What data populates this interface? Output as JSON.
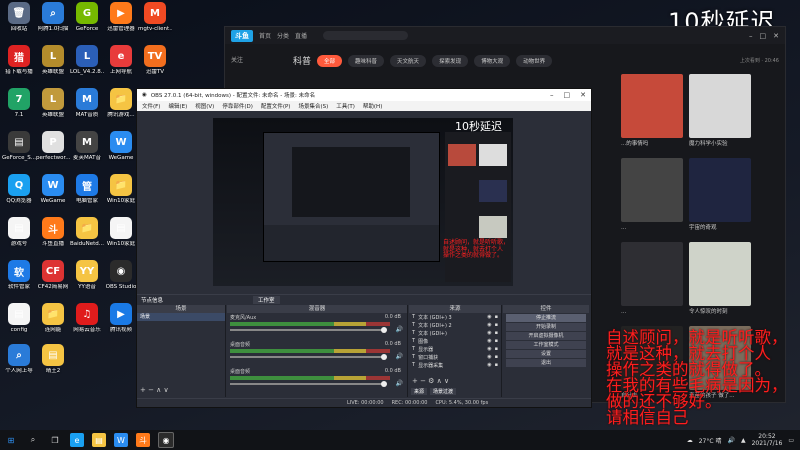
{
  "overlay_title": "10秒延迟",
  "desktop_icons": [
    {
      "label": "回收站",
      "color": "#5a6a85",
      "glyph": "🗑"
    },
    {
      "label": "阿腾1.0扫描\n...",
      "color": "#2a7bd8",
      "glyph": "⌕"
    },
    {
      "label": "GeForce\nExperience",
      "color": "#76b900",
      "glyph": "G"
    },
    {
      "label": "迅雷管理器",
      "color": "#ff7a1a",
      "glyph": "▶"
    },
    {
      "label": "mgtv-client...",
      "color": "#f04a23",
      "glyph": "M"
    },
    {
      "label": "猎下载与播\n放",
      "color": "#d22",
      "glyph": "猎"
    },
    {
      "label": "英雄联盟\nWeGame...",
      "color": "#b48c2c",
      "glyph": "L"
    },
    {
      "label": "LOL_V4.2.8..",
      "color": "#2b5fb8",
      "glyph": "L"
    },
    {
      "label": "上网导航",
      "color": "#e83b3b",
      "glyph": "e"
    },
    {
      "label": "迅雷TV",
      "color": "#f26e1e",
      "glyph": "TV"
    },
    {
      "label": "7.1\nSurrou...",
      "color": "#21a366",
      "glyph": "7"
    },
    {
      "label": "英雄联盟\nWeGame版",
      "color": "#c19a3c",
      "glyph": "L"
    },
    {
      "label": "MAT音质\n...",
      "color": "#2a7bd8",
      "glyph": "M"
    },
    {
      "label": "腾讯游戏...",
      "color": "#f5c443",
      "glyph": "📁"
    },
    {
      "label": "GeForce\nExperience",
      "color": "#76b900",
      "glyph": "G"
    },
    {
      "label": "GeForce_S...",
      "color": "#3a3a3a",
      "glyph": "▤"
    },
    {
      "label": "perfectwor...",
      "color": "#e0e0e0",
      "glyph": "P"
    },
    {
      "label": "麦芙MAT音\n手 V1.6",
      "color": "#444",
      "glyph": "M"
    },
    {
      "label": "WeGame",
      "color": "#2a8cf0",
      "glyph": "W"
    },
    {
      "label": "Profiles",
      "color": "#f5c443",
      "glyph": "📁"
    },
    {
      "label": "QQ浏览器",
      "color": "#1aa0f0",
      "glyph": "Q"
    },
    {
      "label": "WeGame",
      "color": "#2a8cf0",
      "glyph": "W"
    },
    {
      "label": "电脑管家",
      "color": "#1e7ae6",
      "glyph": "管"
    },
    {
      "label": "Win10家庭\n环绕声...",
      "color": "#f5c443",
      "glyph": "📁"
    },
    {
      "label": "7.1\nSurroundS...",
      "color": "#21a366",
      "glyph": "7"
    },
    {
      "label": "游戏号",
      "color": "#f5f5f5",
      "glyph": "▤"
    },
    {
      "label": "斗鱼直播",
      "color": "#ff7a1a",
      "glyph": "斗"
    },
    {
      "label": "BaiduNetd...",
      "color": "#f5c443",
      "glyph": "📁"
    },
    {
      "label": "Win10家庭\n网卡驱动",
      "color": "#f5f5f5",
      "glyph": "▤"
    },
    {
      "label": "Logitech G\nHUB",
      "color": "#222",
      "glyph": "G"
    },
    {
      "label": "软件管家",
      "color": "#1e7ae6",
      "glyph": "软"
    },
    {
      "label": "CF42简易网\n络...",
      "color": "#d33",
      "glyph": "CF"
    },
    {
      "label": "YY语音",
      "color": "#f5c443",
      "glyph": "YY"
    },
    {
      "label": "OBS Studio",
      "color": "#2b2b2b",
      "glyph": "◉"
    },
    {
      "label": "腾讯QQ",
      "color": "#d22",
      "glyph": "QQ"
    },
    {
      "label": "config",
      "color": "#f5f5f5",
      "glyph": "▤"
    },
    {
      "label": "连网能",
      "color": "#f5c443",
      "glyph": "📁"
    },
    {
      "label": "网易云音乐",
      "color": "#e01c1c",
      "glyph": "♫"
    },
    {
      "label": "腾讯视频",
      "color": "#1a7ae6",
      "glyph": "▶"
    },
    {
      "label": "g hub依赖\n...",
      "color": "#ddd",
      "glyph": "⚙"
    },
    {
      "label": "个人网上导\n航",
      "color": "#2a7bd8",
      "glyph": "⌕"
    },
    {
      "label": "晴王2",
      "color": "#f5c443",
      "glyph": "▤"
    }
  ],
  "bg_app": {
    "logo": "斗鱼",
    "tabs": [
      "首页",
      "分类",
      "直播",
      "科普"
    ],
    "category_title": "科普",
    "pills": [
      "全部",
      "趣味科普",
      "天文航天",
      "探索发现",
      "博物大观",
      "动物世界"
    ],
    "follow": "关注",
    "top_right_note": "上次看到 · 20:46",
    "thumbs": [
      {
        "cap": "...的事情吗",
        "bg": "#c64a3a"
      },
      {
        "cap": "魔力科学小实验",
        "bg": "#d8d8d8"
      },
      {
        "cap": "...",
        "bg": "#444"
      },
      {
        "cap": "宇宙的奇观",
        "bg": "#1f2540"
      },
      {
        "cap": "...",
        "bg": "#2e2e33"
      },
      {
        "cap": "令人惊叹的时刻",
        "bg": "#cfd3c9"
      },
      {
        "cap": "自分去",
        "bg": "#222"
      },
      {
        "cap": "青苗的孩子 做了...",
        "bg": "#7a6c5c"
      }
    ]
  },
  "obs": {
    "title": "OBS 27.0.1 (64-bit, windows) - 配置文件: 未命名 - 场景: 未命名",
    "menu": [
      "文件(F)",
      "编辑(E)",
      "视图(V)",
      "停靠部件(D)",
      "配置文件(P)",
      "场景集合(S)",
      "工具(T)",
      "帮助(H)"
    ],
    "preview_title": "10秒延迟",
    "mid_label": "节点信息",
    "studio_mode": "工作室",
    "docks": {
      "scenes_title": "场景",
      "scene_item": "场景",
      "mixer_title": "混音器",
      "sources_title": "来源",
      "controls_title": "控件"
    },
    "mixer_channels": [
      {
        "name": "麦克风/Aux",
        "db": "0.0 dB"
      },
      {
        "name": "桌面音频",
        "db": "0.0 dB"
      },
      {
        "name": "桌面音频",
        "db": "0.0 dB"
      }
    ],
    "sources": [
      "文本 (GDI+) 3",
      "文本 (GDI+) 2",
      "文本 (GDI+)",
      "图像",
      "显示器",
      "窗口捕获",
      "显示器采集"
    ],
    "controls": [
      "停止推流",
      "开始录制",
      "开启虚拟摄像机",
      "工作室模式",
      "设置",
      "退出"
    ],
    "tabs_bottom": [
      "来源",
      "场景过渡"
    ],
    "status": {
      "live": "LIVE: 00:00:00",
      "rec": "REC: 00:00:00",
      "cpu": "CPU: 5.4%, 30.00 fps"
    }
  },
  "red_lines": [
    "自述顾问，就是听听歌，",
    "就是这种，就去打个人",
    "操作之类的就得做了。",
    "在我的有些毛病是因为，",
    "做的还不够好。",
    "请相信自己"
  ],
  "taskbar": {
    "weather": "27°C 晴",
    "time": "20:52",
    "date": "2021/7/16"
  }
}
